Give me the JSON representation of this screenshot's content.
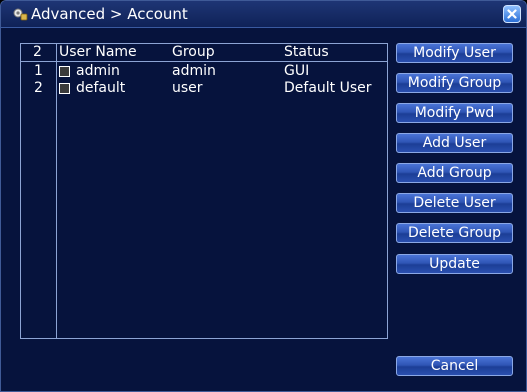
{
  "window": {
    "title": "Advanced > Account"
  },
  "user_list": {
    "headers": {
      "count": "2",
      "user_name": "User Name",
      "group": "Group",
      "status": "Status"
    },
    "rows": [
      {
        "index": "1",
        "user_name": "admin",
        "group": "admin",
        "status": "GUI"
      },
      {
        "index": "2",
        "user_name": "default",
        "group": "user",
        "status": "Default User"
      }
    ]
  },
  "buttons": {
    "modify_user": "Modify User",
    "modify_group": "Modify Group",
    "modify_pwd": "Modify Pwd",
    "add_user": "Add User",
    "add_group": "Add Group",
    "delete_user": "Delete User",
    "delete_group": "Delete Group",
    "update": "Update",
    "cancel": "Cancel"
  },
  "icons": {
    "title": "account-settings-icon",
    "close": "close-icon",
    "row_select": "checkbox-icon"
  },
  "colors": {
    "window_background": "#06133d",
    "title_bar": "#1e3575",
    "grid_lines": "#8da4d4",
    "button": "#2f55b5",
    "text": "#ffffff"
  }
}
